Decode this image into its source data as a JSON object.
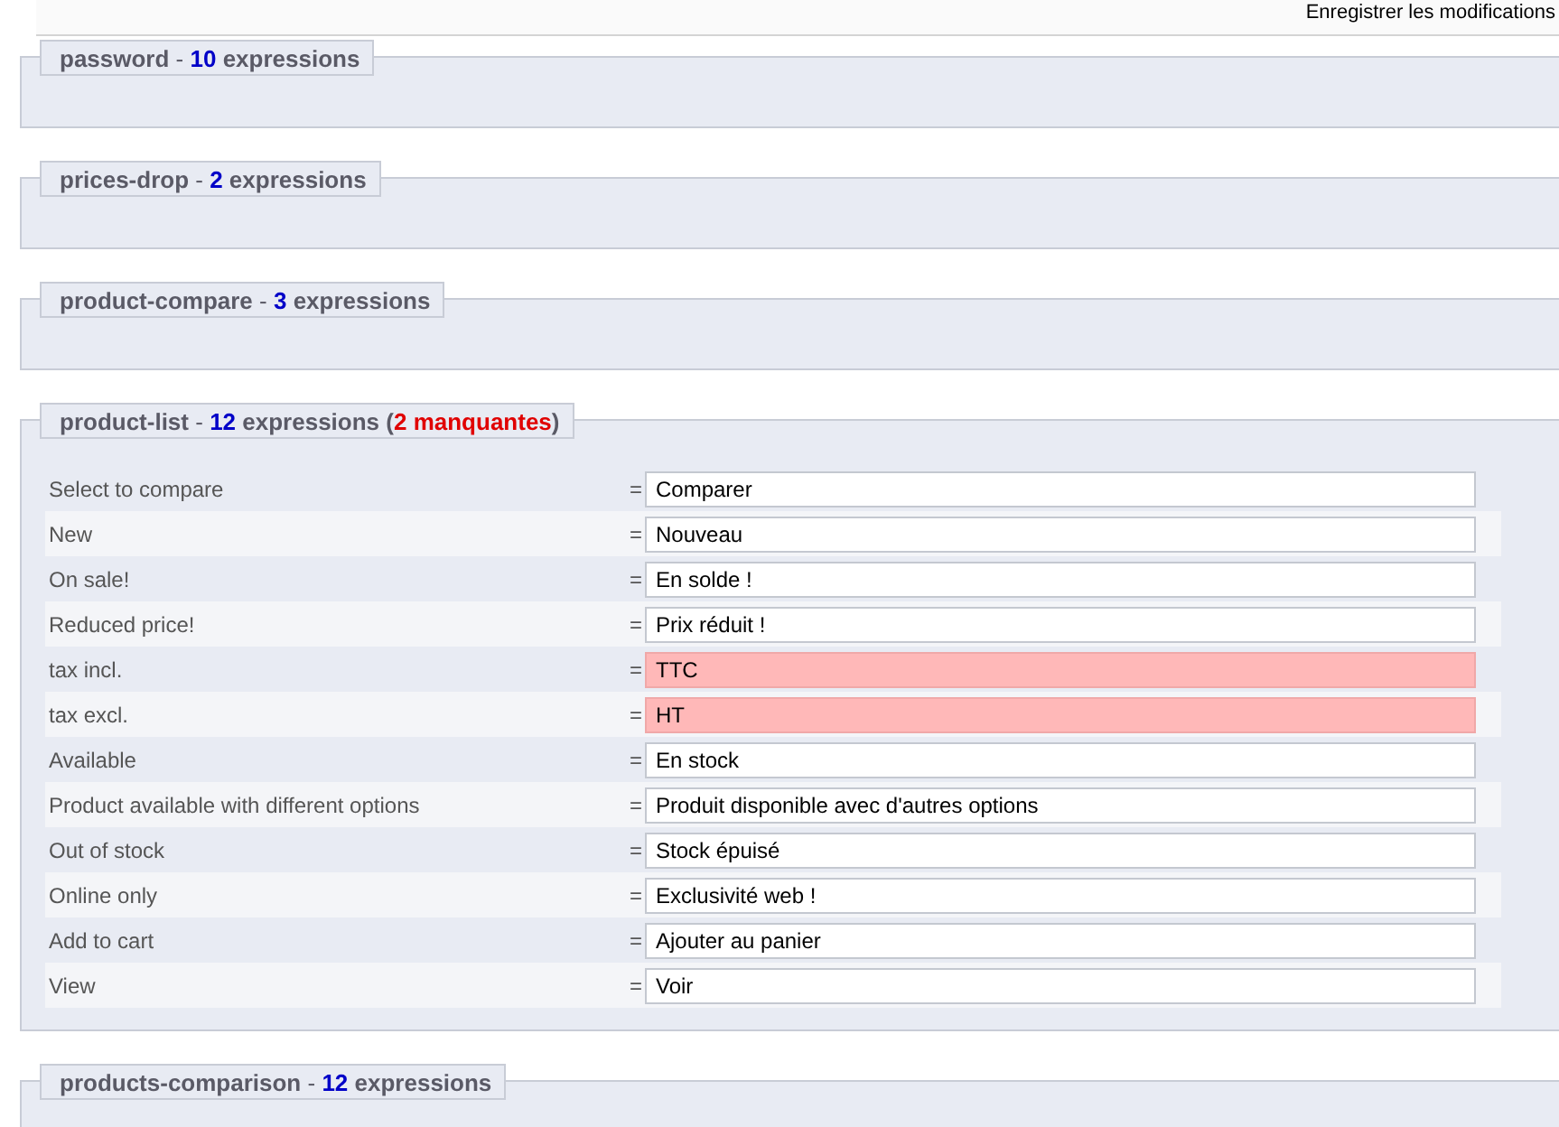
{
  "header": {
    "save_text": "Enregistrer les modifications"
  },
  "sections": [
    {
      "title": "password",
      "separator": "-",
      "count": "10",
      "unit": "expressions"
    },
    {
      "title": "prices-drop",
      "separator": "-",
      "count": "2",
      "unit": "expressions"
    },
    {
      "title": "product-compare",
      "separator": "-",
      "count": "3",
      "unit": "expressions"
    },
    {
      "title": "product-list",
      "separator": "-",
      "count": "12",
      "unit": "expressions",
      "note_open": "(",
      "note": "2 manquantes",
      "note_close": ")",
      "rows": [
        {
          "label": "Select to compare",
          "eq": "=",
          "value": "Comparer",
          "missing": false
        },
        {
          "label": "New",
          "eq": "=",
          "value": "Nouveau",
          "missing": false
        },
        {
          "label": "On sale!",
          "eq": "=",
          "value": "En solde !",
          "missing": false
        },
        {
          "label": "Reduced price!",
          "eq": "=",
          "value": "Prix réduit !",
          "missing": false
        },
        {
          "label": "tax incl.",
          "eq": "=",
          "value": "TTC",
          "missing": true
        },
        {
          "label": "tax excl.",
          "eq": "=",
          "value": "HT",
          "missing": true
        },
        {
          "label": "Available",
          "eq": "=",
          "value": "En stock",
          "missing": false
        },
        {
          "label": "Product available with different options",
          "eq": "=",
          "value": "Produit disponible avec d'autres options",
          "missing": false
        },
        {
          "label": "Out of stock",
          "eq": "=",
          "value": "Stock épuisé",
          "missing": false
        },
        {
          "label": "Online only",
          "eq": "=",
          "value": "Exclusivité web !",
          "missing": false
        },
        {
          "label": "Add to cart",
          "eq": "=",
          "value": "Ajouter au panier",
          "missing": false
        },
        {
          "label": "View",
          "eq": "=",
          "value": "Voir",
          "missing": false
        }
      ]
    },
    {
      "title": "products-comparison",
      "separator": "-",
      "count": "12",
      "unit": "expressions"
    }
  ]
}
